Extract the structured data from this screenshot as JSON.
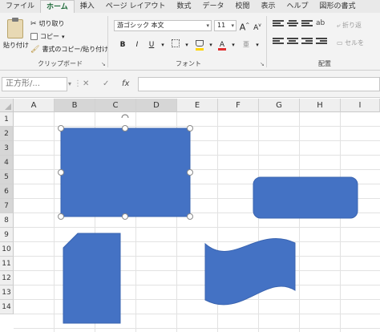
{
  "ribbon_tabs": [
    {
      "label": "ファイル",
      "active": false
    },
    {
      "label": "ホーム",
      "active": true
    },
    {
      "label": "挿入",
      "active": false
    },
    {
      "label": "ページ レイアウト",
      "active": false
    },
    {
      "label": "数式",
      "active": false
    },
    {
      "label": "データ",
      "active": false
    },
    {
      "label": "校閲",
      "active": false
    },
    {
      "label": "表示",
      "active": false
    },
    {
      "label": "ヘルプ",
      "active": false
    },
    {
      "label": "図形の書式",
      "active": false
    }
  ],
  "clipboard": {
    "paste_label": "貼り付け",
    "cut_label": "切り取り",
    "copy_label": "コピー",
    "format_painter_label": "書式のコピー/貼り付け",
    "group_label": "クリップボード"
  },
  "font": {
    "font_name": "游ゴシック 本文",
    "font_size": "11",
    "bold": "B",
    "italic": "I",
    "underline": "U",
    "grow": "A",
    "shrink": "A",
    "font_color_glyph": "A",
    "group_label": "フォント"
  },
  "alignment": {
    "wrap_label": "折り返",
    "merge_label": "セルを",
    "group_label": "配置"
  },
  "formula_bar": {
    "name_box": "正方形/...",
    "cancel": "✕",
    "enter": "✓",
    "fx": "fx",
    "value": ""
  },
  "columns": [
    "A",
    "B",
    "C",
    "D",
    "E",
    "F",
    "G",
    "H",
    "I"
  ],
  "rows": [
    "1",
    "2",
    "3",
    "4",
    "5",
    "6",
    "7",
    "8",
    "9",
    "10",
    "11",
    "12",
    "13",
    "14"
  ],
  "selected_columns": [
    "B",
    "C",
    "D"
  ],
  "selected_rows": [
    "2",
    "3",
    "4",
    "5",
    "6",
    "7"
  ],
  "colors": {
    "shape_fill": "#4472c4",
    "shape_stroke": "#3a64b0",
    "accent_green": "#1f6b3a",
    "font_color_red": "#e03030",
    "fill_color_yellow": "#ffd400"
  }
}
